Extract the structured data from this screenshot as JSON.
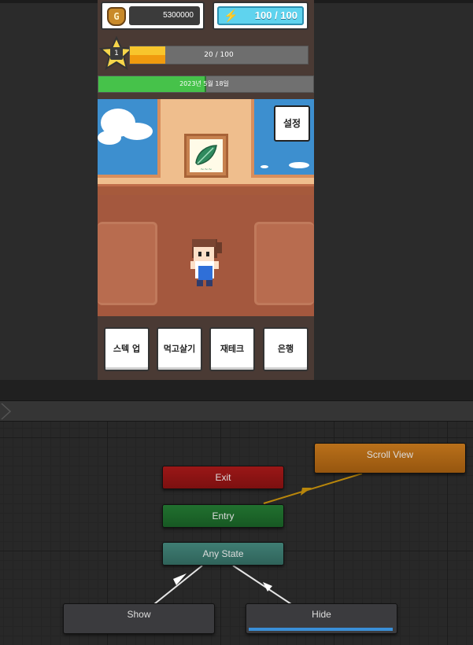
{
  "game": {
    "gold": {
      "icon": "gold-bag-icon",
      "glyph": "G",
      "value": "5300000"
    },
    "energy": {
      "icon": "lightning-icon",
      "glyph": "⚡",
      "value": "100 / 100"
    },
    "level": {
      "icon": "star-icon",
      "value": "1"
    },
    "experience": {
      "text": "20 / 100",
      "progress": 0.2
    },
    "date": {
      "text": "2023년 5월 18일",
      "progress": 0.5
    },
    "settings_label": "설정",
    "menu": [
      {
        "label": "스텍 업"
      },
      {
        "label": "먹고살기"
      },
      {
        "label": "재테크"
      },
      {
        "label": "은행"
      }
    ]
  },
  "animator": {
    "states": {
      "exit": "Exit",
      "entry": "Entry",
      "any_state": "Any State",
      "scroll_view": "Scroll View",
      "show": "Show",
      "hide": "Hide"
    },
    "hide_progress": 0.99,
    "colors": {
      "exit": "#9a1717",
      "entry": "#21712f",
      "any_state": "#3f7d73",
      "scroll_view": "#b9701a",
      "default_state": "#3b3b3e",
      "transition": "#ffffff",
      "entry_transition": "#b8860b",
      "progress": "#3a8fd8"
    }
  }
}
